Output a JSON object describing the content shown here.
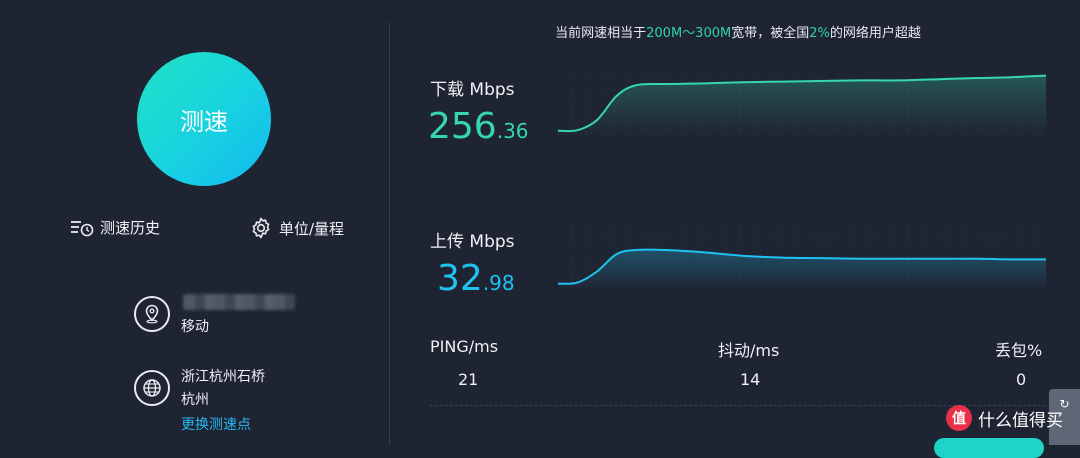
{
  "start_button": {
    "label": "测速"
  },
  "tools": {
    "history": {
      "label": "测速历史",
      "icon": "history-icon"
    },
    "units": {
      "label": "单位/量程",
      "icon": "gear-icon"
    }
  },
  "isp": {
    "name": "移动",
    "icon": "location-pin-icon"
  },
  "server": {
    "name": "浙江杭州石桥",
    "city": "杭州",
    "change_label": "更换测速点",
    "icon": "globe-icon"
  },
  "summary": {
    "prefix": "当前网速相当于",
    "bandwidth": "200M～300M",
    "middle": "宽带，被全国",
    "percent": "2%",
    "suffix": "的网络用户超越"
  },
  "download": {
    "label": "下载 Mbps",
    "value_int": "256",
    "value_dec": ".36",
    "color": "#35d6b1",
    "curve": [
      [
        0,
        0.02
      ],
      [
        0.04,
        0.03
      ],
      [
        0.08,
        0.2
      ],
      [
        0.12,
        0.6
      ],
      [
        0.16,
        0.78
      ],
      [
        0.22,
        0.8
      ],
      [
        0.3,
        0.81
      ],
      [
        0.38,
        0.83
      ],
      [
        0.46,
        0.84
      ],
      [
        0.54,
        0.85
      ],
      [
        0.62,
        0.86
      ],
      [
        0.7,
        0.86
      ],
      [
        0.78,
        0.88
      ],
      [
        0.86,
        0.9
      ],
      [
        0.92,
        0.91
      ],
      [
        0.97,
        0.93
      ],
      [
        1,
        0.94
      ]
    ]
  },
  "upload": {
    "label": "上传 Mbps",
    "value_int": "32",
    "value_dec": ".98",
    "color": "#1ec3f2",
    "curve": [
      [
        0,
        0.04
      ],
      [
        0.04,
        0.06
      ],
      [
        0.08,
        0.25
      ],
      [
        0.12,
        0.55
      ],
      [
        0.16,
        0.62
      ],
      [
        0.22,
        0.62
      ],
      [
        0.3,
        0.58
      ],
      [
        0.38,
        0.52
      ],
      [
        0.46,
        0.49
      ],
      [
        0.54,
        0.48
      ],
      [
        0.62,
        0.47
      ],
      [
        0.7,
        0.47
      ],
      [
        0.78,
        0.47
      ],
      [
        0.86,
        0.47
      ],
      [
        0.92,
        0.46
      ],
      [
        1,
        0.46
      ]
    ]
  },
  "stats": {
    "ping": {
      "label": "PING/ms",
      "value": "21"
    },
    "jitter": {
      "label": "抖动/ms",
      "value": "14"
    },
    "loss": {
      "label": "丢包%",
      "value": "0"
    }
  },
  "watermark": {
    "text": "什么值得买",
    "logo": "值"
  },
  "side_tab": {
    "text": "↻"
  }
}
